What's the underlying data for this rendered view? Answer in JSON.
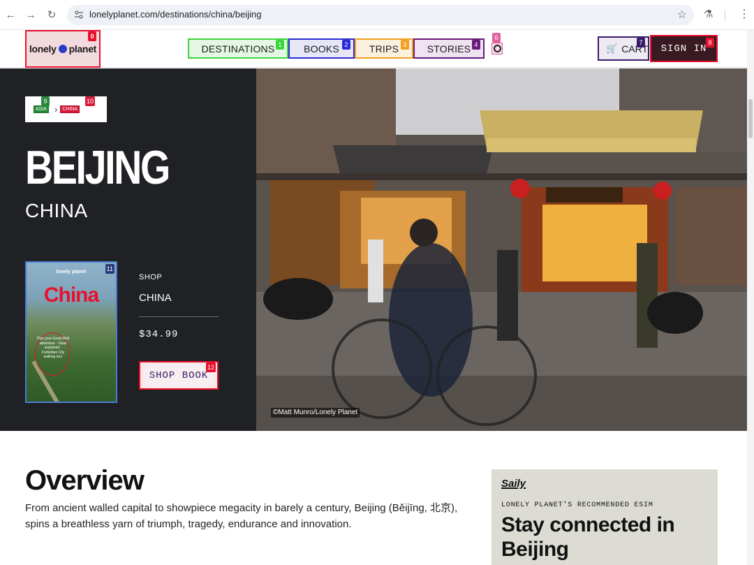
{
  "browser": {
    "url": "lonelyplanet.com/destinations/china/beijing"
  },
  "header": {
    "logo": "lonely planet",
    "nav": [
      {
        "label": "DESTINATIONS",
        "badge": "1"
      },
      {
        "label": "BOOKS",
        "badge": "2"
      },
      {
        "label": "TRIPS",
        "badge": "3"
      },
      {
        "label": "STORIES",
        "badge": "4"
      }
    ],
    "logo_badge": "0",
    "search_badge": "6",
    "cart_label": "CART",
    "cart_badge": "7",
    "signin_label": "SIGN IN",
    "signin_badge": "8"
  },
  "hero": {
    "breadcrumb": [
      {
        "label": "ASIA",
        "badge": "9"
      },
      {
        "label": "CHINA",
        "badge": "10"
      }
    ],
    "city": "BEIJING",
    "country": "CHINA",
    "photo_credit": "©Matt Munro/Lonely Planet"
  },
  "shop": {
    "book_badge": "11",
    "book_publisher": "lonely planet",
    "book_title": "China",
    "book_blurb": "Plan your Great Wall adventure · Visas explained · Forbidden City walking tour",
    "label": "SHOP",
    "country": "CHINA",
    "price": "$34.99",
    "button_label": "SHOP BOOK",
    "button_badge": "12"
  },
  "overview": {
    "title": "Overview",
    "text": "From ancient walled capital to showpiece megacity in barely a century, Beijing (Běijīng, 北京), spins a breathless yarn of triumph, tragedy, endurance and innovation."
  },
  "esim": {
    "brand": "Saily",
    "eyebrow": "LONELY PLANET'S RECOMMENDED ESIM",
    "title": "Stay connected in Beijing"
  },
  "colors": {
    "hero_panel": "#1f2125",
    "accent_red": "#e8112d",
    "signin_bg": "#3a1a22",
    "esim_card": "#dcdbd4"
  }
}
